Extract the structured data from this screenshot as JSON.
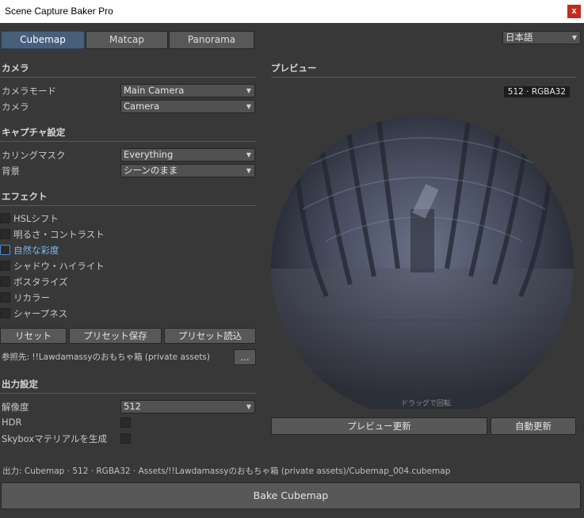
{
  "window": {
    "title": "Scene Capture Baker Pro",
    "close_glyph": "x"
  },
  "tabs": [
    {
      "label": "Cubemap",
      "active": true
    },
    {
      "label": "Matcap",
      "active": false
    },
    {
      "label": "Panorama",
      "active": false
    }
  ],
  "language": {
    "value": "日本語"
  },
  "camera_section": {
    "title": "カメラ",
    "mode_label": "カメラモード",
    "mode_value": "Main Camera",
    "camera_label": "カメラ",
    "camera_value": "Camera"
  },
  "capture_section": {
    "title": "キャプチャ設定",
    "culling_label": "カリングマスク",
    "culling_value": "Everything",
    "background_label": "背景",
    "background_value": "シーンのまま"
  },
  "effects_section": {
    "title": "エフェクト",
    "items": [
      {
        "label": "HSLシフト",
        "checked": false
      },
      {
        "label": "明るさ・コントラスト",
        "checked": false
      },
      {
        "label": "自然な彩度",
        "checked": false,
        "focused": true
      },
      {
        "label": "シャドウ・ハイライト",
        "checked": false
      },
      {
        "label": "ポスタライズ",
        "checked": false
      },
      {
        "label": "リカラー",
        "checked": false
      },
      {
        "label": "シャープネス",
        "checked": false
      }
    ]
  },
  "preset_buttons": {
    "reset": "リセット",
    "save": "プリセット保存",
    "load": "プリセット読込"
  },
  "reference": {
    "text": "参照先: !!Lawdamassyのおもちゃ箱 (private assets)",
    "browse_label": "..."
  },
  "output_section": {
    "title": "出力設定",
    "resolution_label": "解像度",
    "resolution_value": "512",
    "hdr_label": "HDR",
    "hdr_checked": false,
    "skybox_label": "Skyboxマテリアルを生成",
    "skybox_checked": false
  },
  "preview": {
    "title": "プレビュー",
    "badge": "512 · RGBA32",
    "drag_hint": "ドラッグで回転",
    "refresh_label": "プレビュー更新",
    "auto_label": "自動更新"
  },
  "status": {
    "output_path": "出力: Cubemap · 512 · RGBA32 · Assets/!!Lawdamassyのおもちゃ箱 (private assets)/Cubemap_004.cubemap"
  },
  "bake_button": {
    "label": "Bake Cubemap"
  },
  "colors": {
    "accent_tab": "#46607c",
    "background": "#383838",
    "focus_blue": "#4e8ed1"
  },
  "icons": {
    "dropdown": "triangle-down-icon"
  }
}
